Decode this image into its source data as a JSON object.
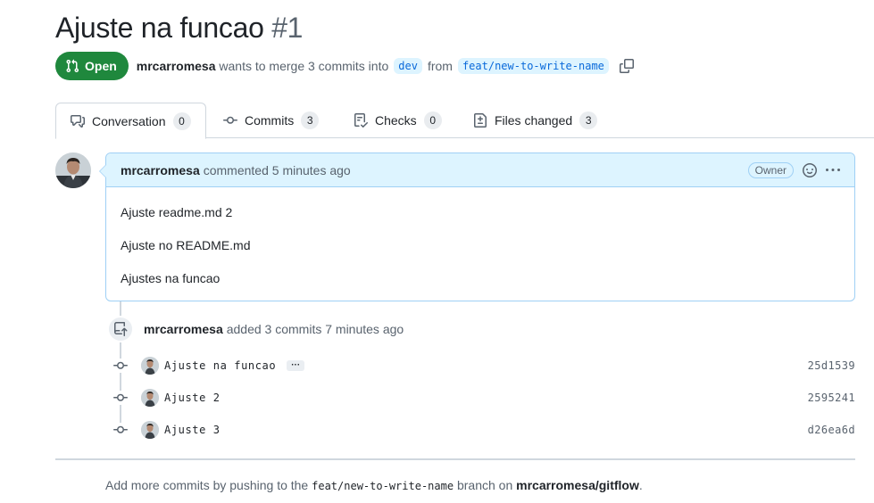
{
  "pr": {
    "title": "Ajuste na funcao",
    "number": "#1",
    "state": "Open",
    "author": "mrcarromesa",
    "merge_text_1": "wants to merge 3 commits into",
    "base_branch": "dev",
    "merge_text_2": "from",
    "head_branch": "feat/new-to-write-name"
  },
  "tabs": [
    {
      "label": "Conversation",
      "count": "0",
      "icon": "comment-discussion-icon"
    },
    {
      "label": "Commits",
      "count": "3",
      "icon": "git-commit-icon"
    },
    {
      "label": "Checks",
      "count": "0",
      "icon": "checklist-icon"
    },
    {
      "label": "Files changed",
      "count": "3",
      "icon": "file-diff-icon"
    }
  ],
  "comment": {
    "author": "mrcarromesa",
    "action": "commented 5 minutes ago",
    "role": "Owner",
    "lines": [
      "Ajuste readme.md 2",
      "Ajuste no README.md",
      "Ajustes na funcao"
    ]
  },
  "push_event": {
    "author": "mrcarromesa",
    "text": "added 3 commits 7 minutes ago"
  },
  "commits": [
    {
      "message": "Ajuste na funcao",
      "sha": "25d1539",
      "has_more": true
    },
    {
      "message": "Ajuste 2",
      "sha": "2595241",
      "has_more": false
    },
    {
      "message": "Ajuste 3",
      "sha": "d26ea6d",
      "has_more": false
    }
  ],
  "footer": {
    "prefix": "Add more commits by pushing to the",
    "branch": "feat/new-to-write-name",
    "middle": "branch on",
    "repo": "mrcarromesa/gitflow",
    "suffix": "."
  },
  "colors": {
    "open_green": "#1f883d",
    "accent_blue": "#0969da",
    "comment_bg": "#ddf4ff"
  }
}
